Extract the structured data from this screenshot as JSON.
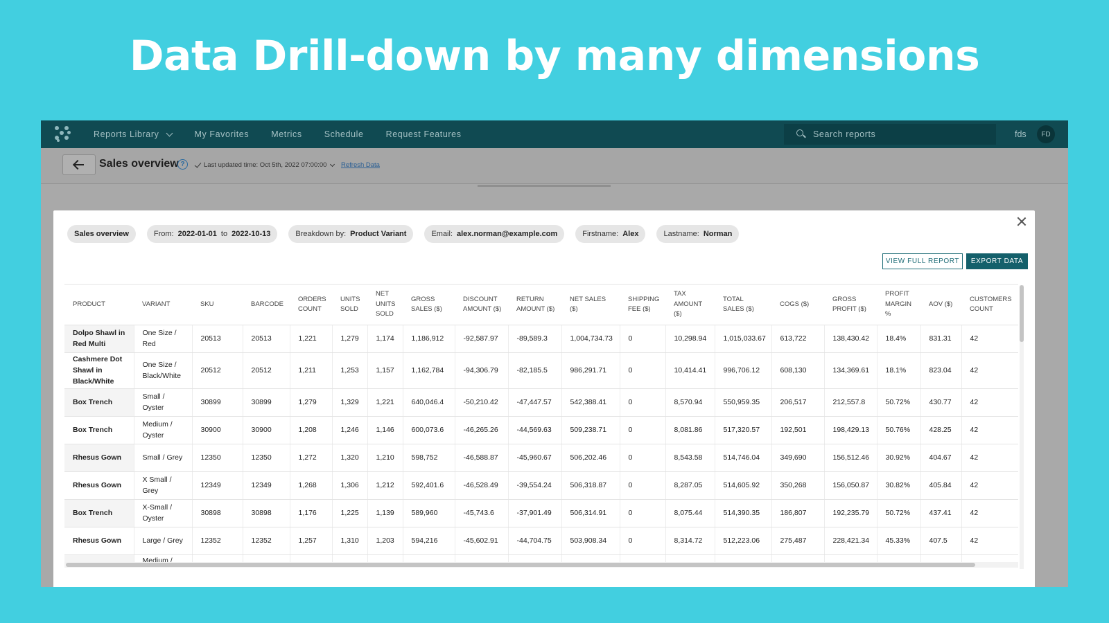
{
  "headline": "Data Drill-down by  many dimensions",
  "nav": {
    "items": [
      "Reports Library",
      "My Favorites",
      "Metrics",
      "Schedule",
      "Request Features"
    ],
    "search_placeholder": "Search reports",
    "user_name": "fds",
    "user_initials": "FD"
  },
  "subbar": {
    "title": "Sales overview",
    "help": "?",
    "last_updated": "Last updated time: Oct 5th, 2022 07:00:00",
    "refresh": "Refresh Data"
  },
  "filters": {
    "report": "Sales overview",
    "from_label": "From:",
    "from": "2022-01-01",
    "to_label": "to",
    "to": "2022-10-13",
    "breakdown_label": "Breakdown by:",
    "breakdown": "Product Variant",
    "email_label": "Email:",
    "email": "alex.norman@example.com",
    "firstname_label": "Firstname:",
    "firstname": "Alex",
    "lastname_label": "Lastname:",
    "lastname": "Norman"
  },
  "actions": {
    "view_full": "VIEW FULL REPORT",
    "export": "EXPORT DATA"
  },
  "table": {
    "columns": [
      "PRODUCT",
      "VARIANT",
      "SKU",
      "BARCODE",
      "ORDERS COUNT",
      "UNITS SOLD",
      "NET UNITS SOLD",
      "GROSS SALES ($)",
      "DISCOUNT AMOUNT ($)",
      "RETURN AMOUNT ($)",
      "NET SALES ($)",
      "SHIPPING FEE ($)",
      "TAX AMOUNT ($)",
      "TOTAL SALES ($)",
      "COGS ($)",
      "GROSS PROFIT ($)",
      "PROFIT MARGIN %",
      "AOV ($)",
      "CUSTOMERS COUNT"
    ],
    "rows": [
      [
        "Dolpo Shawl in Red Multi",
        "One Size / Red",
        "20513",
        "20513",
        "1,221",
        "1,279",
        "1,174",
        "1,186,912",
        "-92,587.97",
        "-89,589.3",
        "1,004,734.73",
        "0",
        "10,298.94",
        "1,015,033.67",
        "613,722",
        "138,430.42",
        "18.4%",
        "831.31",
        "42"
      ],
      [
        "Cashmere Dot Shawl in Black/White",
        "One Size / Black/White",
        "20512",
        "20512",
        "1,211",
        "1,253",
        "1,157",
        "1,162,784",
        "-94,306.79",
        "-82,185.5",
        "986,291.71",
        "0",
        "10,414.41",
        "996,706.12",
        "608,130",
        "134,369.61",
        "18.1%",
        "823.04",
        "42"
      ],
      [
        "Box Trench",
        "Small / Oyster",
        "30899",
        "30899",
        "1,279",
        "1,329",
        "1,221",
        "640,046.4",
        "-50,210.42",
        "-47,447.57",
        "542,388.41",
        "0",
        "8,570.94",
        "550,959.35",
        "206,517",
        "212,557.8",
        "50.72%",
        "430.77",
        "42"
      ],
      [
        "Box Trench",
        "Medium / Oyster",
        "30900",
        "30900",
        "1,208",
        "1,246",
        "1,146",
        "600,073.6",
        "-46,265.26",
        "-44,569.63",
        "509,238.71",
        "0",
        "8,081.86",
        "517,320.57",
        "192,501",
        "198,429.13",
        "50.76%",
        "428.25",
        "42"
      ],
      [
        "Rhesus Gown",
        "Small / Grey",
        "12350",
        "12350",
        "1,272",
        "1,320",
        "1,210",
        "598,752",
        "-46,588.87",
        "-45,960.67",
        "506,202.46",
        "0",
        "8,543.58",
        "514,746.04",
        "349,690",
        "156,512.46",
        "30.92%",
        "404.67",
        "42"
      ],
      [
        "Rhesus Gown",
        "X Small / Grey",
        "12349",
        "12349",
        "1,268",
        "1,306",
        "1,212",
        "592,401.6",
        "-46,528.49",
        "-39,554.24",
        "506,318.87",
        "0",
        "8,287.05",
        "514,605.92",
        "350,268",
        "156,050.87",
        "30.82%",
        "405.84",
        "42"
      ],
      [
        "Box Trench",
        "X-Small / Oyster",
        "30898",
        "30898",
        "1,176",
        "1,225",
        "1,139",
        "589,960",
        "-45,743.6",
        "-37,901.49",
        "506,314.91",
        "0",
        "8,075.44",
        "514,390.35",
        "186,807",
        "192,235.79",
        "50.72%",
        "437.41",
        "42"
      ],
      [
        "Rhesus Gown",
        "Large / Grey",
        "12352",
        "12352",
        "1,257",
        "1,310",
        "1,203",
        "594,216",
        "-45,602.91",
        "-44,704.75",
        "503,908.34",
        "0",
        "8,314.72",
        "512,223.06",
        "275,487",
        "228,421.34",
        "45.33%",
        "407.5",
        "42"
      ],
      [
        "",
        "Medium /",
        "",
        "",
        "",
        "",
        "",
        "",
        "",
        "",
        "",
        "",
        "",
        "",
        "",
        "",
        "",
        "",
        ""
      ]
    ]
  }
}
